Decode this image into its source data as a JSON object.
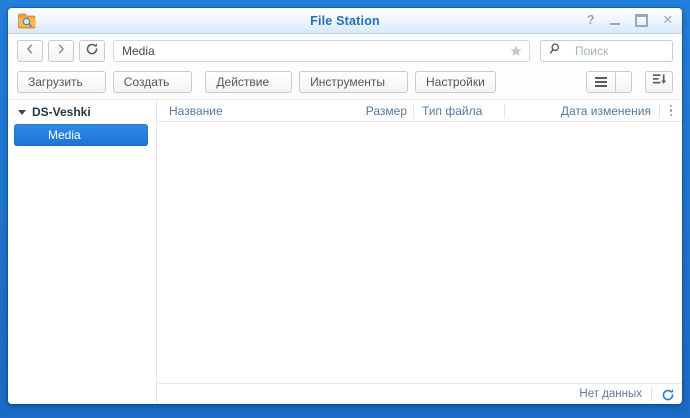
{
  "titlebar": {
    "title": "File Station",
    "help_label": "?",
    "close_label": "✕"
  },
  "navbar": {
    "path": {
      "value": "Media"
    },
    "search": {
      "placeholder": "Поиск"
    }
  },
  "toolbar": {
    "upload_label": "Загрузить",
    "create_label": "Создать",
    "action_label": "Действие",
    "tools_label": "Инструменты",
    "settings_label": "Настройки"
  },
  "sidebar": {
    "root_label": "DS-Veshki",
    "items": [
      {
        "label": "Media",
        "selected": true
      }
    ]
  },
  "table": {
    "columns": [
      {
        "label": "Название"
      },
      {
        "label": "Размер"
      },
      {
        "label": "Тип файла"
      },
      {
        "label": "Дата изменения"
      }
    ]
  },
  "statusbar": {
    "empty_text": "Нет данных"
  },
  "colors": {
    "desktop_blue": "#1e76d3",
    "selection_blue": "#1f7ad6",
    "title_blue": "#2a6db8",
    "header_text": "#56789f",
    "folder_icon_orange": "#efa33b"
  }
}
